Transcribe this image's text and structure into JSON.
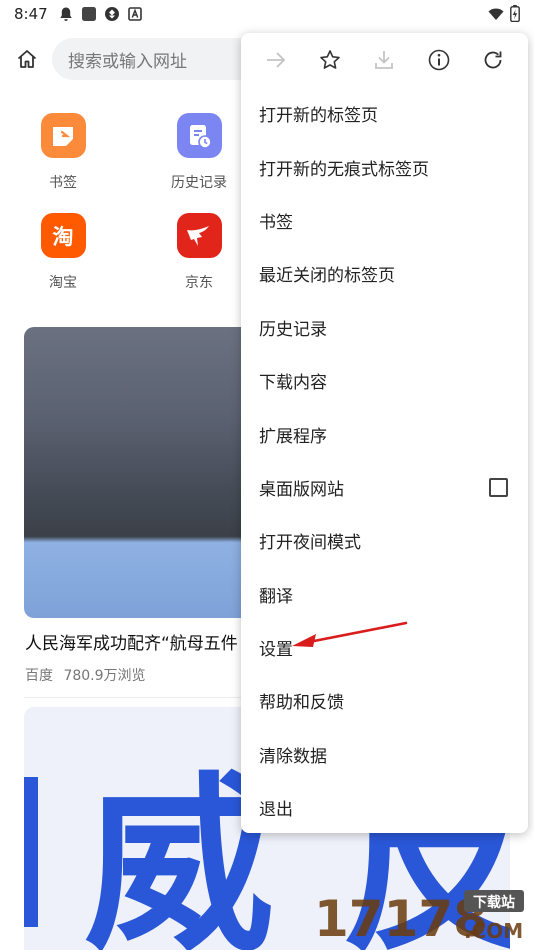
{
  "status_bar": {
    "time": "8:47",
    "left_icons": [
      "notification-bell-icon",
      "app-square-icon",
      "sync-icon",
      "font-icon"
    ],
    "right_icons": [
      "wifi-icon",
      "battery-icon"
    ]
  },
  "address_bar": {
    "placeholder": "搜索或输入网址"
  },
  "shortcuts": [
    {
      "label": "书签",
      "icon": "bookmark-tag-icon",
      "color": "#fb8a3b"
    },
    {
      "label": "历史记录",
      "icon": "history-clock-icon",
      "color": "#7b86f2"
    },
    {
      "label": "淘宝",
      "icon": "taobao-icon",
      "glyph": "淘",
      "color": "#ff5a00"
    },
    {
      "label": "京东",
      "icon": "jd-dog-icon",
      "color": "#e1251b"
    }
  ],
  "feed": [
    {
      "title": "人民海军成功配齐“航母五件",
      "source": "百度",
      "views": "780.9万浏览"
    },
    {
      "image_text": "威 反"
    }
  ],
  "menu": {
    "toolbar": [
      "forward-icon",
      "star-icon",
      "download-icon",
      "info-icon",
      "refresh-icon"
    ],
    "items": [
      {
        "label": "打开新的标签页"
      },
      {
        "label": "打开新的无痕式标签页"
      },
      {
        "label": "书签"
      },
      {
        "label": "最近关闭的标签页"
      },
      {
        "label": "历史记录"
      },
      {
        "label": "下载内容"
      },
      {
        "label": "扩展程序"
      },
      {
        "label": "桌面版网站",
        "checkbox": false
      },
      {
        "label": "打开夜间模式"
      },
      {
        "label": "翻译"
      },
      {
        "label": "设置"
      },
      {
        "label": "帮助和反馈"
      },
      {
        "label": "清除数据"
      },
      {
        "label": "退出"
      }
    ]
  },
  "watermark": {
    "number": "17178",
    "tag": "下载站",
    "domain": ".COM"
  },
  "colors": {
    "menu_bg": "#ffffff",
    "annotation_arrow": "#d91c1c",
    "card_blue_text": "#2a57d8"
  }
}
